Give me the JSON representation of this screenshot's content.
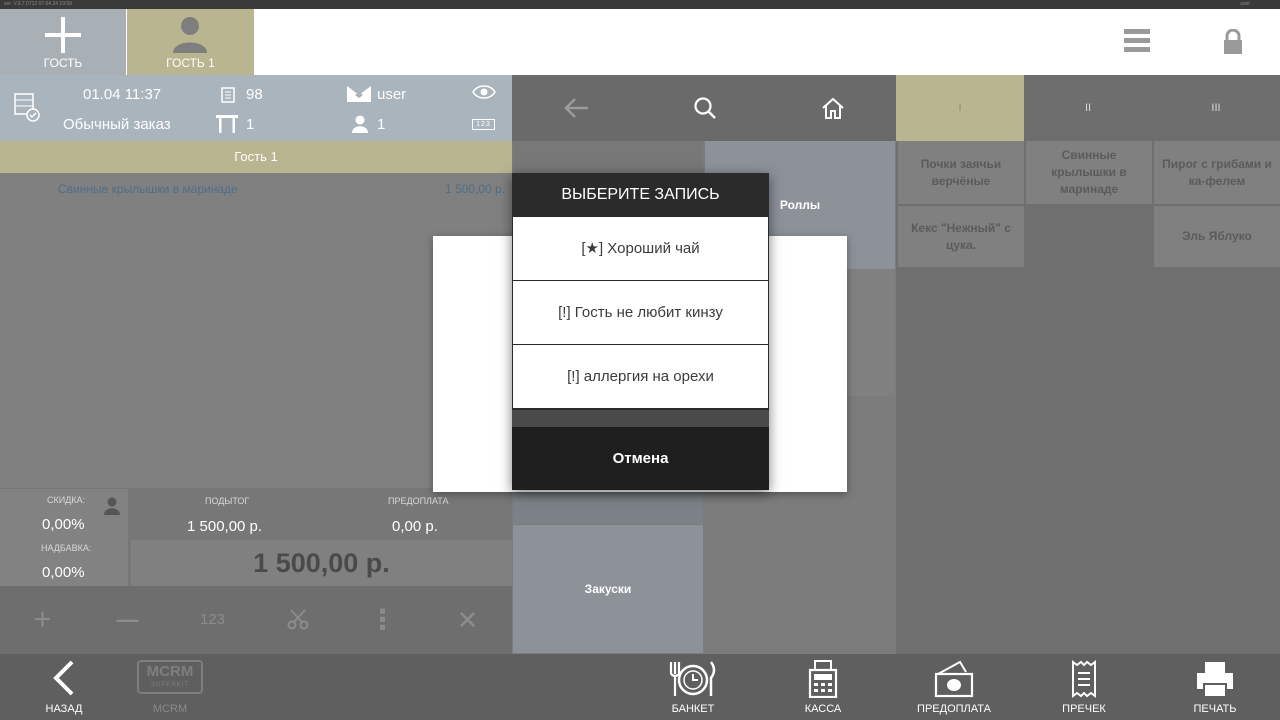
{
  "top_strip": {
    "left": "ver. V.9.7.0712    07.04.24    19:59",
    "right": "user"
  },
  "guests": {
    "add_label": "ГОСТЬ",
    "active_label": "ГОСТЬ 1"
  },
  "order_header": {
    "datetime": "01.04 11:37",
    "order_type": "Обычный заказ",
    "check_number": "98",
    "table_number": "1",
    "waiter": "user",
    "guest_count": "1",
    "keyboard_badge": "123"
  },
  "guest_band": "Гость 1",
  "order_items": [
    {
      "name": "Свинные крылышки в маринаде",
      "price": "1 500,00 р."
    }
  ],
  "totals": {
    "discount_label": "СКИДКА:",
    "discount_value": "0,00%",
    "markup_label": "НАДБАВКА:",
    "markup_value": "0,00%",
    "subtotal_label": "ПОДЫТОГ",
    "subtotal_value": "1 500,00 р.",
    "prepay_label": "ПРЕДОПЛАТА",
    "prepay_value": "0,00 р.",
    "total_value": "1 500,00 р."
  },
  "actions": {
    "plus": "+",
    "minus": "—",
    "qty": "123",
    "more": "⋮",
    "remove": "✕"
  },
  "tabs": [
    "I",
    "II",
    "III"
  ],
  "categories": {
    "rolls": "Роллы",
    "snacks": "Закуски"
  },
  "products": [
    {
      "name": "Почки заячьи верчёные"
    },
    {
      "name": "Свинные крылышки в маринаде"
    },
    {
      "name": "Пирог с грибами и ка-фелем"
    },
    {
      "name": "Кекс \"Нежный\" с цука."
    },
    {
      "name": "Эль Яблуко"
    }
  ],
  "dialog": {
    "title": "ВЫБЕРИТЕ ЗАПИСЬ",
    "items": [
      "[★] Хороший чай",
      "[!] Гость не любит кинзу",
      "[!] аллергия на орехи"
    ],
    "cancel": "Отмена"
  },
  "bottom_bar": {
    "back": "НАЗАД",
    "mcrm_logo": "MCRM",
    "mcrm_sub": "SUPERKIT",
    "mcrm": "MCRM",
    "banquet": "БАНКЕТ",
    "cashier": "КАССА",
    "prepay": "ПРЕДОПЛАТА",
    "precheck": "ПРЕЧЕК",
    "print": "ПЕЧАТЬ"
  }
}
